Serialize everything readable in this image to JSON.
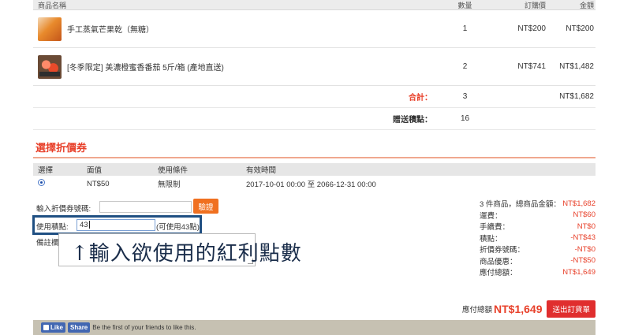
{
  "cart": {
    "headers": {
      "name": "商品名稱",
      "qty": "數量",
      "price": "訂購價",
      "total": "金額"
    },
    "items": [
      {
        "name": "手工蒸氣芒果乾（無糖）",
        "qty": "1",
        "price": "NT$200",
        "total": "NT$200",
        "thumb": "mango-image"
      },
      {
        "name": "[冬季限定] 美濃橙蜜香番茄 5斤/箱 (產地直送)",
        "qty": "2",
        "price": "NT$741",
        "total": "NT$1,482",
        "thumb": "tomato-image"
      }
    ],
    "subtotal": {
      "label": "合計：",
      "qty": "3",
      "total": "NT$1,682"
    },
    "bonus_points": {
      "label": "贈送積點：",
      "value": "16"
    }
  },
  "coupon": {
    "title": "選擇折價券",
    "headers": {
      "select": "選擇",
      "value": "面值",
      "condition": "使用條件",
      "period": "有效時間"
    },
    "rows": [
      {
        "value": "NT$50",
        "condition": "無限制",
        "period": "2017-10-01 00:00 至 2066-12-31 00:00"
      }
    ]
  },
  "form": {
    "coupon_code_label": "輸入折價券號碼:",
    "coupon_code_value": "",
    "verify_label": "驗證",
    "points_label": "使用積點:",
    "points_value": "43",
    "points_hint": "(可使用43點)",
    "note_label": "備註欄:",
    "annotation": "↑輸入欲使用的紅利點數"
  },
  "summary": {
    "rows": [
      {
        "label": "3 件商品，總商品金額：",
        "value": "NT$1,682"
      },
      {
        "label": "運費：",
        "value": "NT$60"
      },
      {
        "label": "手續費：",
        "value": "NT$0"
      },
      {
        "label": "積點：",
        "value": "-NT$43"
      },
      {
        "label": "折價券號碼：",
        "value": "-NT$0"
      },
      {
        "label": "商品優惠：",
        "value": "-NT$50"
      },
      {
        "label": "應付總額：",
        "value": "NT$1,649"
      }
    ],
    "grand_label": "應付總額",
    "grand_value": "NT$1,649",
    "submit_label": "送出訂貨單"
  },
  "facebook": {
    "like_label": "Like",
    "share_label": "Share",
    "text": "Be the first of your friends to like this."
  },
  "colors": {
    "accent": "#e8402a",
    "button_orange": "#f07020",
    "highlight_frame": "#1f4f82",
    "fb_blue": "#4267b2"
  }
}
